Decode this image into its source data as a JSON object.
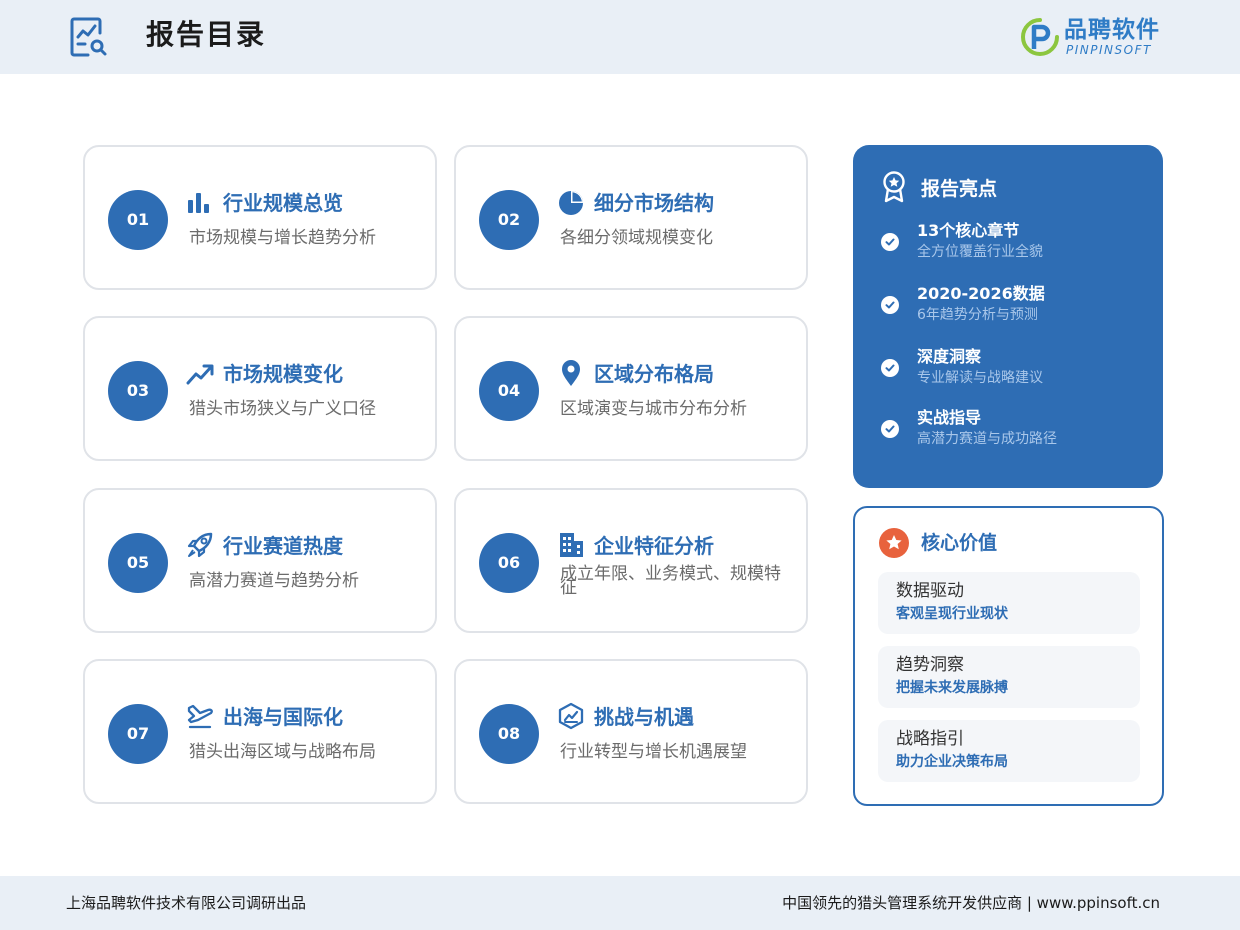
{
  "header": {
    "title": "报告目录",
    "title_icon": "chart-search-icon",
    "logo": {
      "name_cn": "品聘软件",
      "name_en": "PINPINSOFT",
      "icon": "pinpin-logo-mark"
    }
  },
  "sections": [
    {
      "number": "01",
      "title": "行业规模总览",
      "desc": "市场规模与增长趋势分析",
      "icon": "bar-chart-icon"
    },
    {
      "number": "02",
      "title": "细分市场结构",
      "desc": "各细分领域规模变化",
      "icon": "pie-chart-icon"
    },
    {
      "number": "03",
      "title": "市场规模变化",
      "desc": "猎头市场狭义与广义口径",
      "icon": "trend-up-icon"
    },
    {
      "number": "04",
      "title": "区域分布格局",
      "desc": "区域演变与城市分布分析",
      "icon": "map-pin-icon"
    },
    {
      "number": "05",
      "title": "行业赛道热度",
      "desc": "高潜力赛道与趋势分析",
      "icon": "rocket-icon"
    },
    {
      "number": "06",
      "title": "企业特征分析",
      "desc": "成立年限、业务模式、规模特征",
      "icon": "building-icon"
    },
    {
      "number": "07",
      "title": "出海与国际化",
      "desc": "猎头出海区域与战略布局",
      "icon": "plane-icon"
    },
    {
      "number": "08",
      "title": "挑战与机遇",
      "desc": "行业转型与增长机遇展望",
      "icon": "hexagon-chart-icon"
    }
  ],
  "highlights": {
    "title": "报告亮点",
    "icon": "award-ribbon-icon",
    "items": [
      {
        "main": "13个核心章节",
        "sub": "全方位覆盖行业全貌"
      },
      {
        "main": "2020-2026数据",
        "sub": "6年趋势分析与预测"
      },
      {
        "main": "深度洞察",
        "sub": "专业解读与战略建议"
      },
      {
        "main": "实战指导",
        "sub": "高潜力赛道与成功路径"
      }
    ]
  },
  "core_values": {
    "title": "核心价值",
    "icon": "star-badge-icon",
    "items": [
      {
        "main": "数据驱动",
        "sub": "客观呈现行业现状"
      },
      {
        "main": "趋势洞察",
        "sub": "把握未来发展脉搏"
      },
      {
        "main": "战略指引",
        "sub": "助力企业决策布局"
      }
    ]
  },
  "footer": {
    "left": "上海品聘软件技术有限公司调研出品",
    "right": "中国领先的猎头管理系统开发供应商 | www.ppinsoft.cn"
  },
  "colors": {
    "primary": "#2e6db4",
    "header_bg": "#e9eff6",
    "accent_orange": "#e8623d",
    "logo_green": "#8cc63f"
  }
}
